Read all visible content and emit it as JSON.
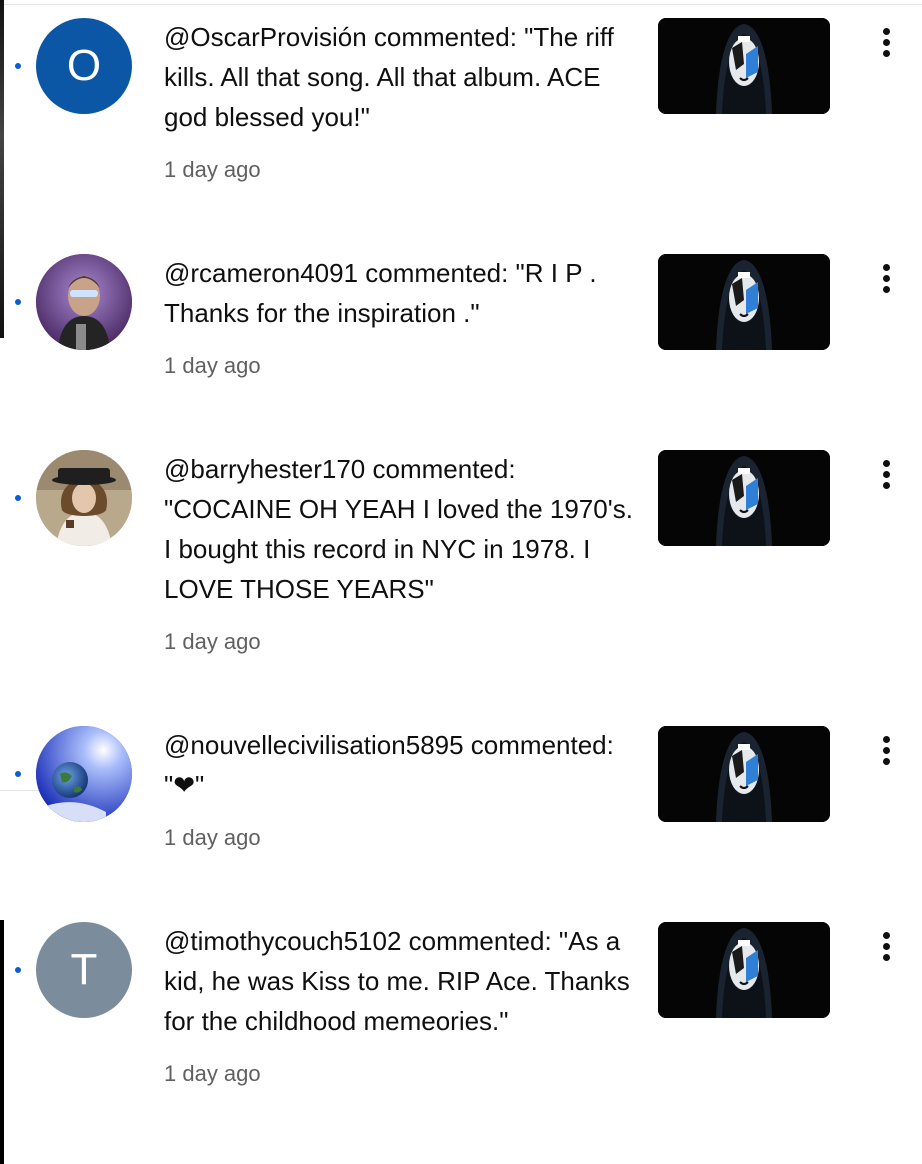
{
  "notifications": [
    {
      "avatar_letter": "O",
      "avatar_color": "#0b57a5",
      "comment": "@OscarProvisión commented: \"The riff kills. All that song. All that album. ACE god blessed you!\"",
      "time": "1 day ago"
    },
    {
      "avatar_color": "#6a3f86",
      "comment": "@rcameron4091 commented: \"R I P . Thanks for the inspiration .\"",
      "time": "1 day ago"
    },
    {
      "avatar_color": "#c8b9a3",
      "comment": "@barryhester170 commented: \"COCAINE OH YEAH I loved the 1970's. I bought this record in NYC in 1978. I LOVE THOSE YEARS\"",
      "time": "1 day ago"
    },
    {
      "avatar_color": "#2b4fd1",
      "comment": "@nouvellecivilisation5895 commented: \"❤\"",
      "time": "1 day ago"
    },
    {
      "avatar_letter": "T",
      "avatar_color": "#7b8d9c",
      "comment": "@timothycouch5102 commented: \"As a kid, he was Kiss to me. RIP Ace. Thanks for the childhood memeories.\"",
      "time": "1 day ago"
    }
  ],
  "colors": {
    "unread_dot": "#065fd4",
    "text": "#0f0f0f",
    "secondary_text": "#606060"
  },
  "icons": {
    "menu": "more-vert-icon",
    "thumbnail": "video-thumbnail"
  }
}
